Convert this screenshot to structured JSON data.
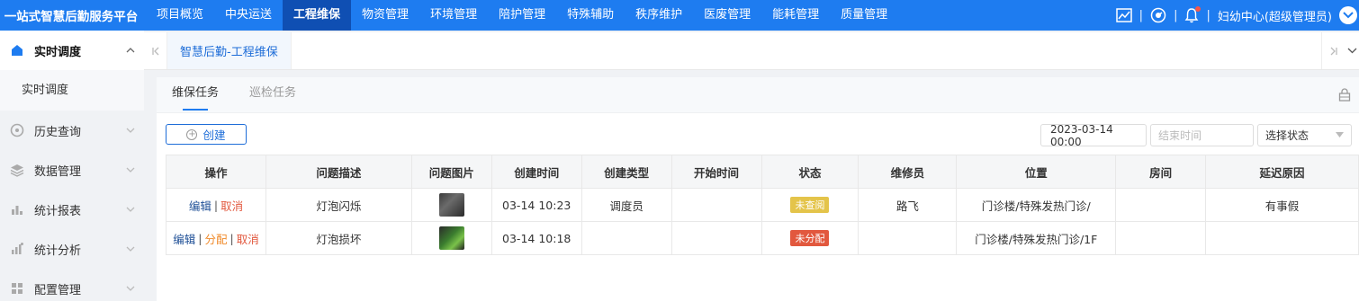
{
  "app": {
    "brand": "一站式智慧后勤服务平台"
  },
  "nav": {
    "items": [
      "项目概览",
      "中央运送",
      "工程维保",
      "物资管理",
      "环境管理",
      "陪护管理",
      "特殊辅助",
      "秩序维护",
      "医废管理",
      "能耗管理",
      "质量管理"
    ],
    "active": "工程维保"
  },
  "top_right": {
    "user_text": "妇幼中心(超级管理员)",
    "separator": "|"
  },
  "sidebar": {
    "groups": [
      {
        "label": "实时调度",
        "icon": "home-icon",
        "open": true,
        "subitems": [
          "实时调度"
        ]
      },
      {
        "label": "历史查询",
        "icon": "history-icon"
      },
      {
        "label": "数据管理",
        "icon": "layers-icon"
      },
      {
        "label": "统计报表",
        "icon": "bar-chart-icon"
      },
      {
        "label": "统计分析",
        "icon": "analysis-icon"
      },
      {
        "label": "配置管理",
        "icon": "grid-icon"
      }
    ]
  },
  "tabstrip": {
    "active_tab": "智慧后勤-工程维保"
  },
  "subtabs": {
    "items": [
      "维保任务",
      "巡检任务"
    ],
    "active": "维保任务"
  },
  "toolbar": {
    "create_label": "创建",
    "start_date": "2023-03-14 00:00",
    "end_placeholder": "结束时间",
    "status_placeholder": "选择状态"
  },
  "table": {
    "headers": [
      "操作",
      "问题描述",
      "问题图片",
      "创建时间",
      "创建类型",
      "开始时间",
      "状态",
      "维修员",
      "位置",
      "房间",
      "延迟原因"
    ],
    "actions": {
      "edit": "编辑",
      "cancel": "取消",
      "assign": "分配"
    },
    "rows": [
      {
        "description": "灯泡闪烁",
        "created": "03-14 10:23",
        "create_type": "调度员",
        "start": "",
        "status": "未查阅",
        "repairer": "路飞",
        "location": "门诊楼/特殊发热门诊/",
        "room": "",
        "delay_reason": "有事假"
      },
      {
        "description": "灯泡损坏",
        "created": "03-14 10:18",
        "create_type": "",
        "start": "",
        "status": "未分配",
        "repairer": "",
        "location": "门诊楼/特殊发热门诊/1F",
        "room": "",
        "delay_reason": ""
      }
    ]
  },
  "colors": {
    "primary": "#1e7cf0",
    "nav_active": "#0f4fb3",
    "status_unread": "#e4c44a",
    "status_unassigned": "#e2583e"
  }
}
